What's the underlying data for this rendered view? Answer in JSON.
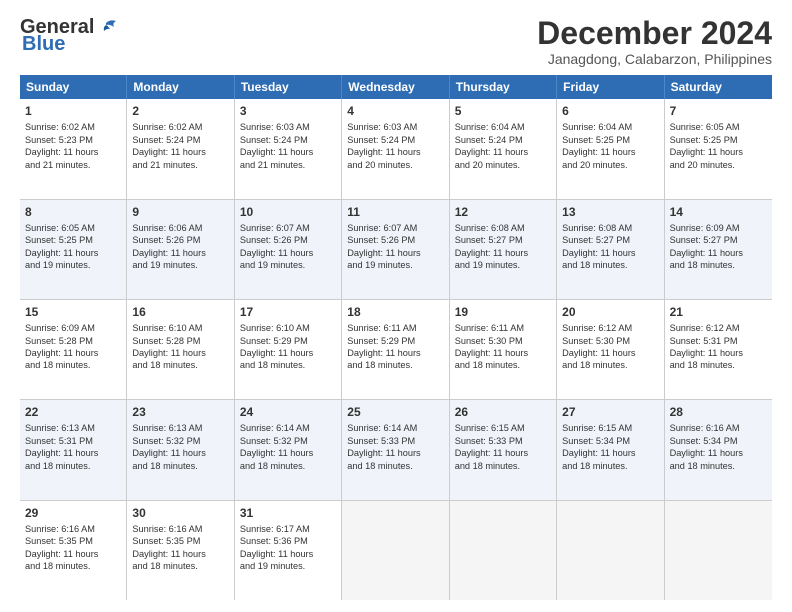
{
  "logo": {
    "line1": "General",
    "line2": "Blue"
  },
  "title": "December 2024",
  "subtitle": "Janagdong, Calabarzon, Philippines",
  "header_days": [
    "Sunday",
    "Monday",
    "Tuesday",
    "Wednesday",
    "Thursday",
    "Friday",
    "Saturday"
  ],
  "weeks": [
    [
      {
        "day": "1",
        "lines": [
          "Sunrise: 6:02 AM",
          "Sunset: 5:23 PM",
          "Daylight: 11 hours",
          "and 21 minutes."
        ]
      },
      {
        "day": "2",
        "lines": [
          "Sunrise: 6:02 AM",
          "Sunset: 5:24 PM",
          "Daylight: 11 hours",
          "and 21 minutes."
        ]
      },
      {
        "day": "3",
        "lines": [
          "Sunrise: 6:03 AM",
          "Sunset: 5:24 PM",
          "Daylight: 11 hours",
          "and 21 minutes."
        ]
      },
      {
        "day": "4",
        "lines": [
          "Sunrise: 6:03 AM",
          "Sunset: 5:24 PM",
          "Daylight: 11 hours",
          "and 20 minutes."
        ]
      },
      {
        "day": "5",
        "lines": [
          "Sunrise: 6:04 AM",
          "Sunset: 5:24 PM",
          "Daylight: 11 hours",
          "and 20 minutes."
        ]
      },
      {
        "day": "6",
        "lines": [
          "Sunrise: 6:04 AM",
          "Sunset: 5:25 PM",
          "Daylight: 11 hours",
          "and 20 minutes."
        ]
      },
      {
        "day": "7",
        "lines": [
          "Sunrise: 6:05 AM",
          "Sunset: 5:25 PM",
          "Daylight: 11 hours",
          "and 20 minutes."
        ]
      }
    ],
    [
      {
        "day": "8",
        "lines": [
          "Sunrise: 6:05 AM",
          "Sunset: 5:25 PM",
          "Daylight: 11 hours",
          "and 19 minutes."
        ]
      },
      {
        "day": "9",
        "lines": [
          "Sunrise: 6:06 AM",
          "Sunset: 5:26 PM",
          "Daylight: 11 hours",
          "and 19 minutes."
        ]
      },
      {
        "day": "10",
        "lines": [
          "Sunrise: 6:07 AM",
          "Sunset: 5:26 PM",
          "Daylight: 11 hours",
          "and 19 minutes."
        ]
      },
      {
        "day": "11",
        "lines": [
          "Sunrise: 6:07 AM",
          "Sunset: 5:26 PM",
          "Daylight: 11 hours",
          "and 19 minutes."
        ]
      },
      {
        "day": "12",
        "lines": [
          "Sunrise: 6:08 AM",
          "Sunset: 5:27 PM",
          "Daylight: 11 hours",
          "and 19 minutes."
        ]
      },
      {
        "day": "13",
        "lines": [
          "Sunrise: 6:08 AM",
          "Sunset: 5:27 PM",
          "Daylight: 11 hours",
          "and 18 minutes."
        ]
      },
      {
        "day": "14",
        "lines": [
          "Sunrise: 6:09 AM",
          "Sunset: 5:27 PM",
          "Daylight: 11 hours",
          "and 18 minutes."
        ]
      }
    ],
    [
      {
        "day": "15",
        "lines": [
          "Sunrise: 6:09 AM",
          "Sunset: 5:28 PM",
          "Daylight: 11 hours",
          "and 18 minutes."
        ]
      },
      {
        "day": "16",
        "lines": [
          "Sunrise: 6:10 AM",
          "Sunset: 5:28 PM",
          "Daylight: 11 hours",
          "and 18 minutes."
        ]
      },
      {
        "day": "17",
        "lines": [
          "Sunrise: 6:10 AM",
          "Sunset: 5:29 PM",
          "Daylight: 11 hours",
          "and 18 minutes."
        ]
      },
      {
        "day": "18",
        "lines": [
          "Sunrise: 6:11 AM",
          "Sunset: 5:29 PM",
          "Daylight: 11 hours",
          "and 18 minutes."
        ]
      },
      {
        "day": "19",
        "lines": [
          "Sunrise: 6:11 AM",
          "Sunset: 5:30 PM",
          "Daylight: 11 hours",
          "and 18 minutes."
        ]
      },
      {
        "day": "20",
        "lines": [
          "Sunrise: 6:12 AM",
          "Sunset: 5:30 PM",
          "Daylight: 11 hours",
          "and 18 minutes."
        ]
      },
      {
        "day": "21",
        "lines": [
          "Sunrise: 6:12 AM",
          "Sunset: 5:31 PM",
          "Daylight: 11 hours",
          "and 18 minutes."
        ]
      }
    ],
    [
      {
        "day": "22",
        "lines": [
          "Sunrise: 6:13 AM",
          "Sunset: 5:31 PM",
          "Daylight: 11 hours",
          "and 18 minutes."
        ]
      },
      {
        "day": "23",
        "lines": [
          "Sunrise: 6:13 AM",
          "Sunset: 5:32 PM",
          "Daylight: 11 hours",
          "and 18 minutes."
        ]
      },
      {
        "day": "24",
        "lines": [
          "Sunrise: 6:14 AM",
          "Sunset: 5:32 PM",
          "Daylight: 11 hours",
          "and 18 minutes."
        ]
      },
      {
        "day": "25",
        "lines": [
          "Sunrise: 6:14 AM",
          "Sunset: 5:33 PM",
          "Daylight: 11 hours",
          "and 18 minutes."
        ]
      },
      {
        "day": "26",
        "lines": [
          "Sunrise: 6:15 AM",
          "Sunset: 5:33 PM",
          "Daylight: 11 hours",
          "and 18 minutes."
        ]
      },
      {
        "day": "27",
        "lines": [
          "Sunrise: 6:15 AM",
          "Sunset: 5:34 PM",
          "Daylight: 11 hours",
          "and 18 minutes."
        ]
      },
      {
        "day": "28",
        "lines": [
          "Sunrise: 6:16 AM",
          "Sunset: 5:34 PM",
          "Daylight: 11 hours",
          "and 18 minutes."
        ]
      }
    ],
    [
      {
        "day": "29",
        "lines": [
          "Sunrise: 6:16 AM",
          "Sunset: 5:35 PM",
          "Daylight: 11 hours",
          "and 18 minutes."
        ]
      },
      {
        "day": "30",
        "lines": [
          "Sunrise: 6:16 AM",
          "Sunset: 5:35 PM",
          "Daylight: 11 hours",
          "and 18 minutes."
        ]
      },
      {
        "day": "31",
        "lines": [
          "Sunrise: 6:17 AM",
          "Sunset: 5:36 PM",
          "Daylight: 11 hours",
          "and 19 minutes."
        ]
      },
      null,
      null,
      null,
      null
    ]
  ]
}
